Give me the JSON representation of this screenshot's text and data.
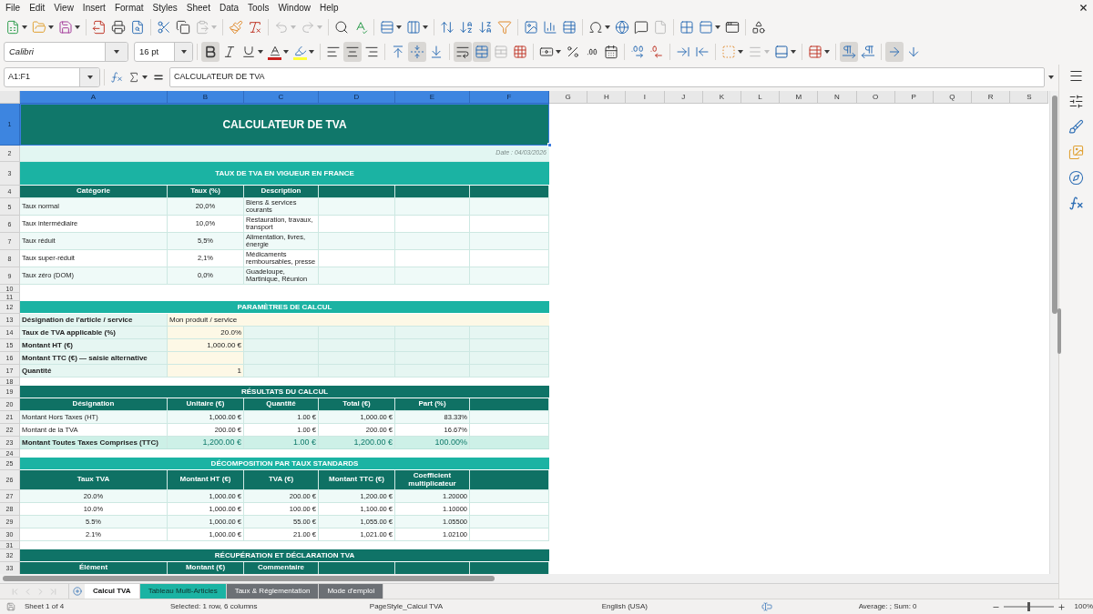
{
  "menu_bar": {
    "items": [
      "File",
      "Edit",
      "View",
      "Insert",
      "Format",
      "Styles",
      "Sheet",
      "Data",
      "Tools",
      "Window",
      "Help"
    ]
  },
  "standard_toolbar": {
    "paste_disabled": true,
    "undo_disabled": true,
    "redo_disabled": true,
    "header_footer_disabled": true
  },
  "formatting_toolbar": {
    "font_name": "Calibri",
    "font_size": "16 pt",
    "bold": true,
    "italic": false,
    "underline": false,
    "align_left": false,
    "align_center": true,
    "align_right": false,
    "align_top": false,
    "align_middle": true,
    "align_bottom": false,
    "wrap_text": true,
    "merge_and_center": true,
    "merge_cells_disabled": true,
    "border_style_disabled": true,
    "left_to_right": true,
    "right_to_left": false,
    "text_horizontal": true,
    "text_vertical": false
  },
  "formula_bar": {
    "name_box": "A1:F1",
    "formula": "CALCULATEUR DE TVA"
  },
  "columns": [
    {
      "label": "A",
      "selected": true
    },
    {
      "label": "B",
      "selected": true
    },
    {
      "label": "C",
      "selected": true
    },
    {
      "label": "D",
      "selected": true
    },
    {
      "label": "E",
      "selected": true
    },
    {
      "label": "F",
      "selected": true
    },
    {
      "label": "G",
      "selected": false
    },
    {
      "label": "H",
      "selected": false
    },
    {
      "label": "I",
      "selected": false
    },
    {
      "label": "J",
      "selected": false
    },
    {
      "label": "K",
      "selected": false
    },
    {
      "label": "L",
      "selected": false
    },
    {
      "label": "M",
      "selected": false
    },
    {
      "label": "N",
      "selected": false
    },
    {
      "label": "O",
      "selected": false
    },
    {
      "label": "P",
      "selected": false
    },
    {
      "label": "Q",
      "selected": false
    },
    {
      "label": "R",
      "selected": false
    },
    {
      "label": "S",
      "selected": false
    }
  ],
  "sheet": {
    "rows": [
      {
        "number": "1",
        "selected": true,
        "kind": "title",
        "text": "CALCULATEUR DE TVA"
      },
      {
        "number": "2",
        "selected": false,
        "kind": "note",
        "text": "Date : 04/03/2026"
      },
      {
        "number": "3",
        "selected": false,
        "kind": "heading",
        "text": "TAUX DE TVA EN VIGUEUR EN FRANCE",
        "color": "#1bb3a3"
      },
      {
        "number": "4",
        "selected": false,
        "kind": "header",
        "cells": [
          "Catégorie",
          "Taux (%)",
          "Description"
        ]
      },
      {
        "number": "5",
        "selected": false,
        "kind": "rate",
        "cells": [
          "Taux normal",
          "20,0%",
          "Biens & services courants"
        ]
      },
      {
        "number": "6",
        "selected": false,
        "kind": "rate",
        "cells": [
          "Taux intermédiaire",
          "10,0%",
          "Restauration, travaux, transport"
        ]
      },
      {
        "number": "7",
        "selected": false,
        "kind": "rate",
        "cells": [
          "Taux réduit",
          "5,5%",
          "Alimentation, livres, énergie"
        ]
      },
      {
        "number": "8",
        "selected": false,
        "kind": "rate",
        "cells": [
          "Taux super-réduit",
          "2,1%",
          "Médicaments remboursables, presse"
        ]
      },
      {
        "number": "9",
        "selected": false,
        "kind": "rate",
        "cells": [
          "Taux zéro (DOM)",
          "0,0%",
          "Guadeloupe, Martinique, Réunion"
        ]
      },
      {
        "number": "10",
        "selected": false,
        "kind": "blank"
      },
      {
        "number": "11",
        "selected": false,
        "kind": "blank"
      },
      {
        "number": "12",
        "selected": false,
        "kind": "banner",
        "text": "PARAMÈTRES DE CALCUL",
        "color": "#1bb3a3"
      },
      {
        "number": "13",
        "selected": false,
        "kind": "entry",
        "cells": [
          "Désignation de l'article / service",
          "Mon produit / service"
        ]
      },
      {
        "number": "14",
        "selected": false,
        "kind": "param",
        "cells": [
          "Taux de TVA applicable (%)",
          "20.0%"
        ]
      },
      {
        "number": "15",
        "selected": false,
        "kind": "param",
        "cells": [
          "Montant HT (€)",
          "1,000.00 €"
        ]
      },
      {
        "number": "16",
        "selected": false,
        "kind": "param",
        "cells": [
          "Montant TTC (€) — saisie alternative"
        ]
      },
      {
        "number": "17",
        "selected": false,
        "kind": "param",
        "cells": [
          "Quantité",
          "1"
        ]
      },
      {
        "number": "18",
        "selected": false,
        "kind": "blank"
      },
      {
        "number": "19",
        "selected": false,
        "kind": "banner",
        "text": "RÉSULTATS DU CALCUL",
        "color": "#0f7367"
      },
      {
        "number": "20",
        "selected": false,
        "kind": "header",
        "cells": [
          "Désignation",
          "Unitaire (€)",
          "Quantité",
          "Total (€)",
          "Part (%)"
        ]
      },
      {
        "number": "21",
        "selected": false,
        "kind": "result",
        "cells": [
          "Montant Hors Taxes (HT)",
          "1,000.00 €",
          "1.00 €",
          "1,000.00 €",
          "83.33%"
        ]
      },
      {
        "number": "22",
        "selected": false,
        "kind": "result",
        "cells": [
          "Montant de la TVA",
          "200.00 €",
          "1.00 €",
          "200.00 €",
          "16.67%"
        ]
      },
      {
        "number": "23",
        "selected": false,
        "kind": "total",
        "cells": [
          "Montant Toutes Taxes Comprises (TTC)",
          "1,200.00 €",
          "1.00 €",
          "1,200.00 €",
          "100.00%"
        ]
      },
      {
        "number": "24",
        "selected": false,
        "kind": "blank"
      },
      {
        "number": "25",
        "selected": false,
        "kind": "banner",
        "text": "DÉCOMPOSITION PAR TAUX STANDARDS",
        "color": "#1bb3a3"
      },
      {
        "number": "26",
        "selected": false,
        "kind": "header",
        "cells": [
          "Taux TVA",
          "Montant HT (€)",
          "TVA (€)",
          "Montant TTC (€)",
          "Coefficient multiplicateur"
        ]
      },
      {
        "number": "27",
        "selected": false,
        "kind": "breakdown",
        "cells": [
          "20.0%",
          "1,000.00 €",
          "200.00 €",
          "1,200.00 €",
          "1.20000"
        ]
      },
      {
        "number": "28",
        "selected": false,
        "kind": "breakdown",
        "cells": [
          "10.0%",
          "1,000.00 €",
          "100.00 €",
          "1,100.00 €",
          "1.10000"
        ]
      },
      {
        "number": "29",
        "selected": false,
        "kind": "breakdown",
        "cells": [
          "5.5%",
          "1,000.00 €",
          "55.00 €",
          "1,055.00 €",
          "1.05500"
        ]
      },
      {
        "number": "30",
        "selected": false,
        "kind": "breakdown",
        "cells": [
          "2.1%",
          "1,000.00 €",
          "21.00 €",
          "1,021.00 €",
          "1.02100"
        ]
      },
      {
        "number": "31",
        "selected": false,
        "kind": "blank"
      },
      {
        "number": "32",
        "selected": false,
        "kind": "banner",
        "text": "RÉCUPÉRATION ET DÉCLARATION TVA",
        "color": "#0f7367"
      },
      {
        "number": "33",
        "selected": false,
        "kind": "header",
        "cells": [
          "Élément",
          "Montant (€)",
          "Commentaire"
        ]
      }
    ]
  },
  "sheet_tabs": {
    "tabs": [
      {
        "label": "Calcul TVA",
        "selected": true
      },
      {
        "label": "Tableau Multi-Articles",
        "selected": false,
        "color": "#1bb3a3"
      },
      {
        "label": "Taux & Réglementation",
        "selected": false,
        "color": "#6c7075"
      },
      {
        "label": "Mode d'emploi",
        "selected": false,
        "color": "#6c7075"
      }
    ]
  },
  "status_bar": {
    "sheet": "Sheet 1 of 4",
    "selection": "Selected: 1 row, 6 columns",
    "page_style": "PageStyle_Calcul TVA",
    "language": "English (USA)",
    "summary": "Average: ; Sum: 0",
    "zoom": {
      "level": 0.5,
      "reading": "100%"
    }
  }
}
